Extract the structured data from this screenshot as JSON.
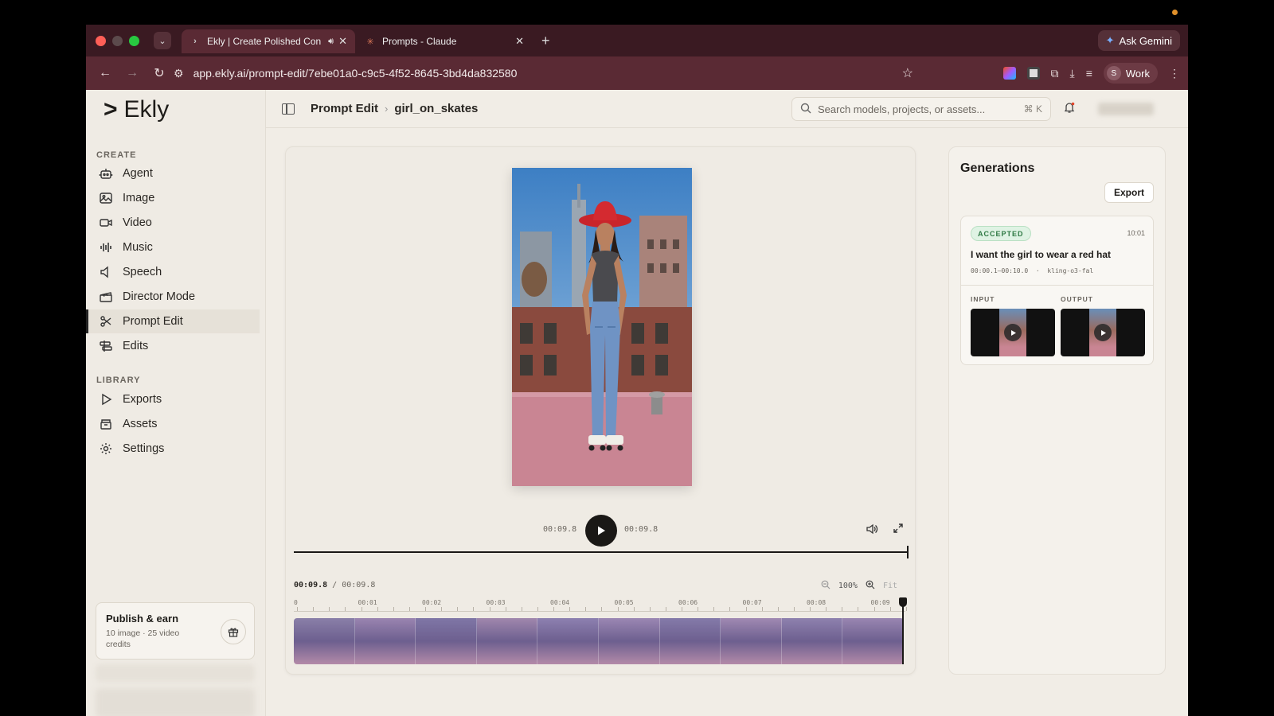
{
  "browser": {
    "tabs": [
      {
        "title": "Ekly | Create Polished Con",
        "active": true
      },
      {
        "title": "Prompts - Claude",
        "active": false
      }
    ],
    "url": "app.ekly.ai/prompt-edit/7ebe01a0-c9c5-4f52-8645-3bd4da832580",
    "gemini_label": "Ask Gemini",
    "profile_initial": "S",
    "profile_label": "Work"
  },
  "sidebar": {
    "logo": "Ekly",
    "create_label": "CREATE",
    "create_items": [
      {
        "label": "Agent",
        "icon": "robot-icon"
      },
      {
        "label": "Image",
        "icon": "image-icon"
      },
      {
        "label": "Video",
        "icon": "video-icon"
      },
      {
        "label": "Music",
        "icon": "waveform-icon"
      },
      {
        "label": "Speech",
        "icon": "speaker-icon"
      },
      {
        "label": "Director Mode",
        "icon": "clapper-icon"
      },
      {
        "label": "Prompt Edit",
        "icon": "scissors-icon",
        "active": true
      },
      {
        "label": "Edits",
        "icon": "edits-icon"
      }
    ],
    "library_label": "LIBRARY",
    "library_items": [
      {
        "label": "Exports",
        "icon": "play-outline-icon"
      },
      {
        "label": "Assets",
        "icon": "archive-icon"
      },
      {
        "label": "Settings",
        "icon": "gear-icon"
      }
    ],
    "publish": {
      "title": "Publish & earn",
      "subtitle": "10 image · 25 video credits"
    }
  },
  "header": {
    "breadcrumb_parent": "Prompt Edit",
    "breadcrumb_current": "girl_on_skates",
    "search_placeholder": "Search models, projects, or assets...",
    "search_shortcut": "⌘ K"
  },
  "player": {
    "current_time": "00:09.8",
    "duration": "00:09.8",
    "timeline_current": "00:09.8",
    "timeline_total": "00:09.8",
    "zoom": "100%",
    "fit_label": "Fit",
    "ruler_labels": [
      "0",
      "00:01",
      "00:02",
      "00:03",
      "00:04",
      "00:05",
      "00:06",
      "00:07",
      "00:08",
      "00:09"
    ],
    "progress": 1.0
  },
  "generations": {
    "title": "Generations",
    "export_label": "Export",
    "items": [
      {
        "status": "ACCEPTED",
        "time": "10:01",
        "prompt": "I want the girl to wear a red hat",
        "range": "00:00.1–00:10.0",
        "model": "kling-o3-fal",
        "input_label": "INPUT",
        "output_label": "OUTPUT"
      }
    ]
  },
  "colors": {
    "accent": "#1a1816",
    "accepted_bg": "#dff3e4",
    "accepted_text": "#2f7a45",
    "browser_chrome": "#5a2a34"
  }
}
